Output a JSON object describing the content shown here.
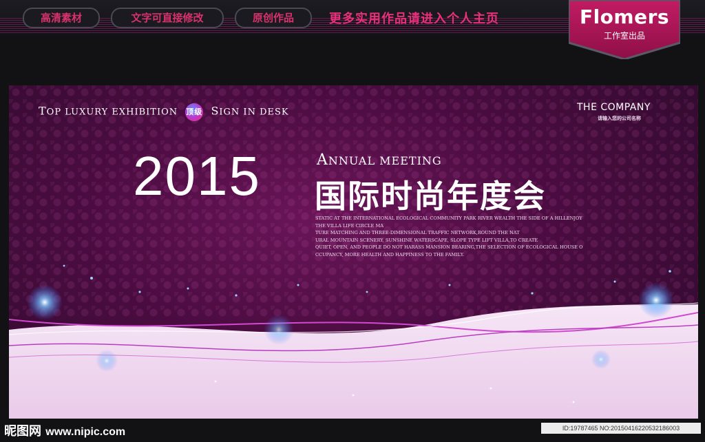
{
  "header": {
    "tags": [
      "高清素材",
      "文字可直接修改",
      "原创作品"
    ],
    "promo": "更多实用作品请进入个人主页",
    "badge": {
      "brand": "Flomers",
      "subtitle": "工作室出品"
    }
  },
  "banner": {
    "top_left": {
      "part1_cap": "T",
      "part1_rest": "OP LUXURY EXHIBITION",
      "seal": "顶级",
      "part2_cap": "S",
      "part2_rest": "IGN IN DESK"
    },
    "company": {
      "name": "THE COMPANY",
      "subtitle": "请输入您的公司名称"
    },
    "year": "2015",
    "annual": {
      "cap1": "A",
      "rest1": "NNUAL",
      "rest2": "MEETING"
    },
    "cn_title": "国际时尚年度会",
    "body_lines": [
      "STATIC AT THE INTERNATIONAL ECOLOGICAL COMMUNITY PARK RIVER WEALTH THE SIDE OF A HILLENJOY",
      "THE VILLA LIFE CIRCLE MA",
      "TURE MATCHING AND THREE-DIMENSIONAL TRAFFIC NETWORK,ROUND THE NAT",
      "URAL MOUNTAIN SCENERY, SUNSHINE WATERSCAPE, SLOPE TYPE LIFT VILLA,TO CREATE",
      "QUIET, OPEN, AND PEOPLE DO NOT HARASS MANSION BEARING,THE SELECTION OF ECOLOGICAL HOUSE O",
      "CCUPANCY, MORE HEALTH AND HAPPINESS TO THE FAMILY."
    ]
  },
  "watermark": {
    "left_cn": "昵图网",
    "left_url": "www.nipic.com",
    "right": "ID:19787465 NO:20150416220532186003"
  },
  "colors": {
    "accent": "#e8307a",
    "banner_base": "#4a0c40",
    "wave": "#f2dff2"
  }
}
